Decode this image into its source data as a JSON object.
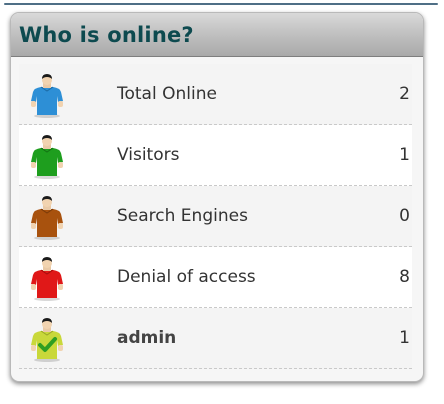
{
  "widget": {
    "title": "Who is online?"
  },
  "rows": [
    {
      "label": "Total Online",
      "count": "2",
      "icon": "user-blue-icon",
      "color": "#2d8fd6"
    },
    {
      "label": "Visitors",
      "count": "1",
      "icon": "user-green-icon",
      "color": "#1e9e1e"
    },
    {
      "label": "Search Engines",
      "count": "0",
      "icon": "user-brown-icon",
      "color": "#a8520e"
    },
    {
      "label": "Denial of access",
      "count": "8",
      "icon": "user-red-icon",
      "color": "#e01818"
    },
    {
      "label": "admin",
      "count": "1",
      "icon": "user-admin-check-icon",
      "color": "#c9d83a"
    }
  ]
}
